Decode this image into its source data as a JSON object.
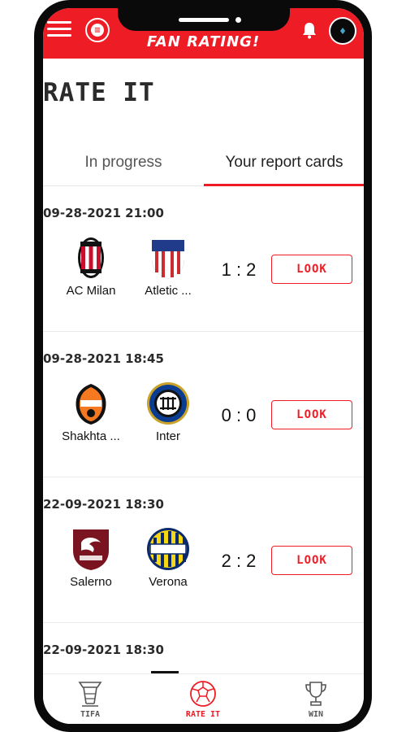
{
  "header": {
    "title": "FAN RATING!",
    "accent_color": "#ee1c25",
    "menu_icon": "hamburger-icon",
    "logo_icon": "app-logo-icon",
    "notifications_icon": "bell-icon",
    "avatar_icon": "avatar"
  },
  "page": {
    "title": "RATE IT"
  },
  "tabs": [
    {
      "label": "In progress",
      "selected": false
    },
    {
      "label": "Your report cards",
      "selected": true
    }
  ],
  "matches": [
    {
      "datetime": "09-28-2021 21:00",
      "home": "AC Milan",
      "away": "Atletic ...",
      "score": "1 : 2",
      "action": "LOOK"
    },
    {
      "datetime": "09-28-2021 18:45",
      "home": "Shakhta ...",
      "away": "Inter",
      "score": "0 : 0",
      "action": "LOOK"
    },
    {
      "datetime": "22-09-2021 18:30",
      "home": "Salerno",
      "away": "Verona",
      "score": "2 : 2",
      "action": "LOOK"
    },
    {
      "datetime": "22-09-2021 18:30"
    }
  ],
  "bottom_nav": [
    {
      "label": "TIFA",
      "icon": "stadium-icon",
      "active": false
    },
    {
      "label": "RATE IT",
      "icon": "soccer-ball-icon",
      "active": true
    },
    {
      "label": "WIN",
      "icon": "trophy-icon",
      "active": false
    }
  ]
}
